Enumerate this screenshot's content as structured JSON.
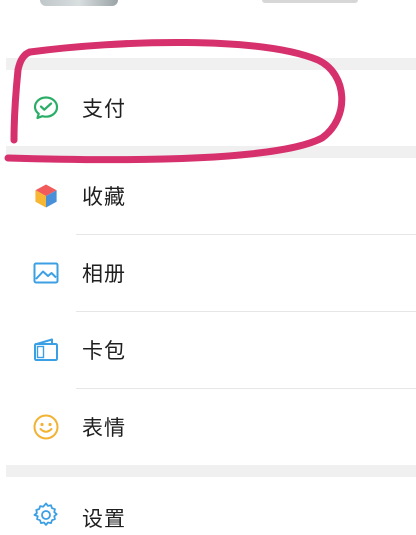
{
  "menu": {
    "section1": [
      {
        "id": "pay",
        "label": "支付",
        "icon": "wechat-pay-icon",
        "accent": "#2aae67"
      }
    ],
    "section2": [
      {
        "id": "favorites",
        "label": "收藏",
        "icon": "favorites-cube-icon"
      },
      {
        "id": "album",
        "label": "相册",
        "icon": "album-icon"
      },
      {
        "id": "card-wallet",
        "label": "卡包",
        "icon": "card-wallet-icon"
      },
      {
        "id": "stickers",
        "label": "表情",
        "icon": "sticker-smile-icon"
      }
    ],
    "section3": [
      {
        "id": "settings",
        "label": "设置",
        "icon": "settings-gear-icon"
      }
    ]
  },
  "annotation": {
    "color": "#d6306d",
    "shape": "hand-drawn-ellipse"
  }
}
